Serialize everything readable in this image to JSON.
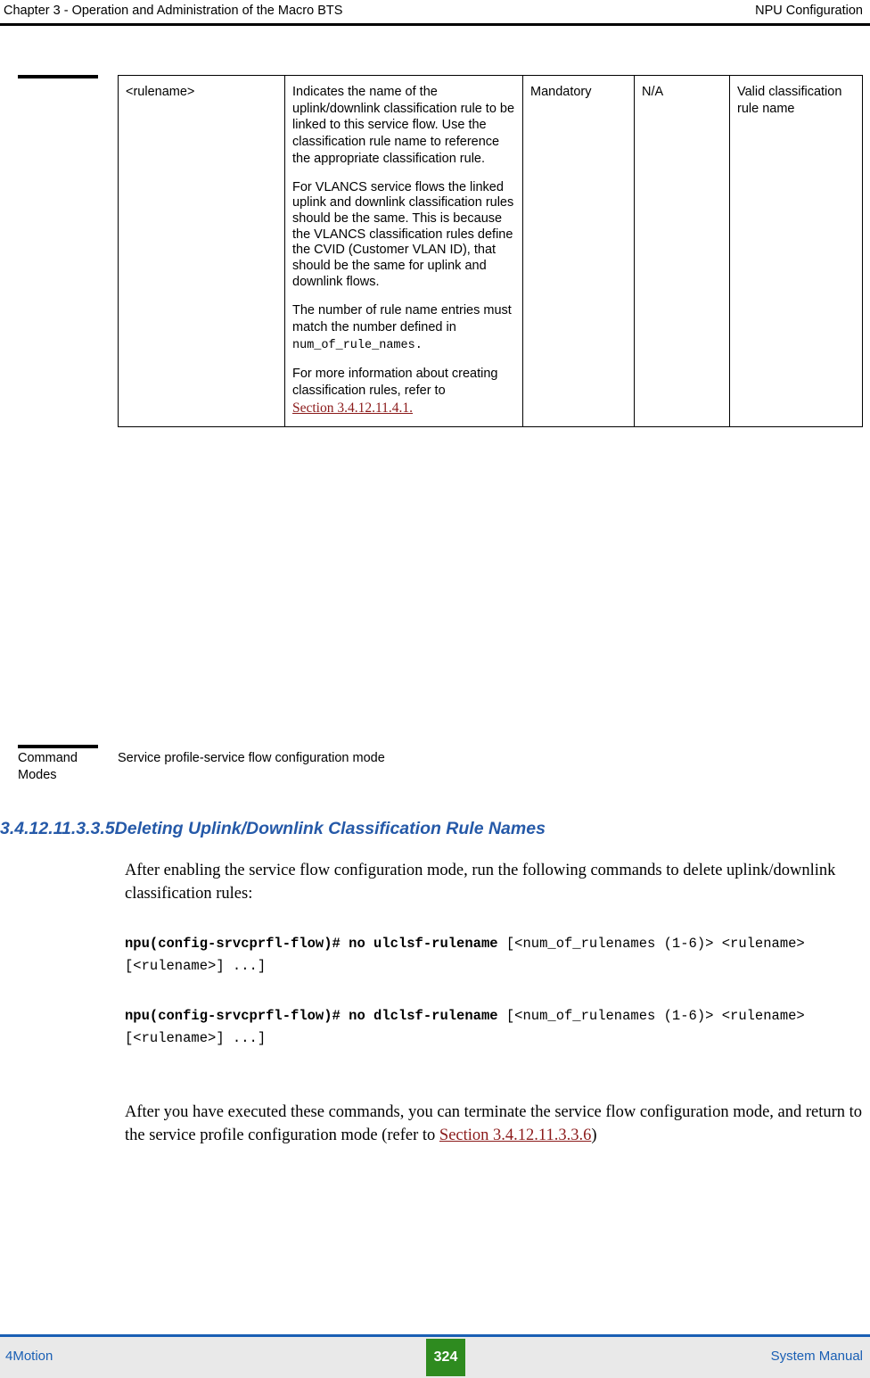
{
  "header": {
    "left": "Chapter 3 - Operation and Administration of the Macro BTS",
    "right": "NPU Configuration"
  },
  "table": {
    "row": {
      "name": "<rulename>",
      "description_paragraphs": [
        "Indicates the name of the uplink/downlink classification rule to be linked to this service flow. Use the classification rule name to reference the appropriate classification rule.",
        "For VLANCS service flows the linked uplink and downlink classification rules should be the same. This is because the VLANCS classification rules define the CVID (Customer VLAN ID), that should be the same for uplink and downlink flows.",
        "The number of rule name entries must match the number defined in",
        "For more information about creating classification rules, refer to"
      ],
      "description_mono": "num_of_rule_names.",
      "description_xref": "Section 3.4.12.11.4.1.",
      "mandatory": "Mandatory",
      "default": "N/A",
      "valid_range": "Valid classification rule name"
    }
  },
  "command_modes": {
    "label": "Command Modes",
    "value": "Service profile-service flow configuration mode"
  },
  "section": {
    "number": "3.4.12.11.3.3.5",
    "title": "Deleting Uplink/Downlink Classification Rule Names"
  },
  "body": {
    "para1": "After enabling the service flow configuration mode, run the following commands to delete uplink/downlink classification rules:",
    "command1_bold": "npu(config-srvcprfl-flow)# no ulclsf-rulename",
    "command1_args": " [<num_of_rulenames (1-6)> <rulename> [<rulename>] ...]",
    "command2_bold": "npu(config-srvcprfl-flow)# no dlclsf-rulename",
    "command2_args": " [<num_of_rulenames (1-6)> <rulename> [<rulename>] ...]",
    "para2_before": "After you have executed these commands, you can terminate the service flow configuration mode, and return to the service profile configuration mode (refer to ",
    "para2_xref": "Section 3.4.12.11.3.3.6",
    "para2_after": ")"
  },
  "footer": {
    "left": "4Motion",
    "page": "324",
    "right": "System Manual"
  }
}
